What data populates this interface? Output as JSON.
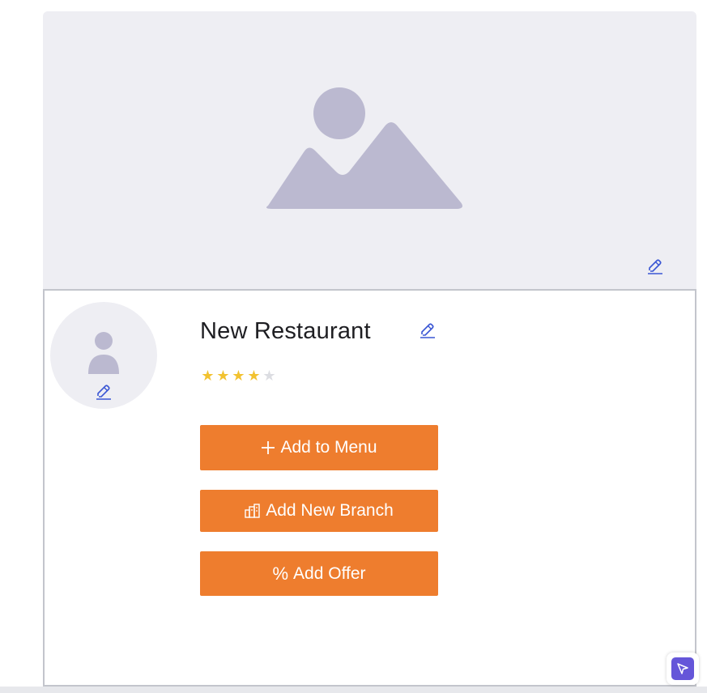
{
  "restaurant": {
    "name": "New Restaurant",
    "rating": 4,
    "rating_max": 5
  },
  "icons": {
    "cover_placeholder": "image-placeholder-icon",
    "avatar_placeholder": "user-placeholder-icon",
    "edit": "pencil-icon",
    "add": "plus-icon",
    "branch": "building-icon",
    "offer": "percent-icon",
    "pointer": "cursor-arrow-icon"
  },
  "buttons": {
    "add_to_menu": "Add to Menu",
    "add_branch": "Add New Branch",
    "add_offer": "Add Offer",
    "add_icon_glyph": "+",
    "offer_icon_glyph": "%"
  },
  "colors": {
    "accent": "#ee7d2e",
    "star_filled": "#f2c230",
    "star_empty": "#dcdde2",
    "placeholder": "#bbb9d0",
    "edit_link": "#3a56d4",
    "fab": "#6556d9"
  }
}
